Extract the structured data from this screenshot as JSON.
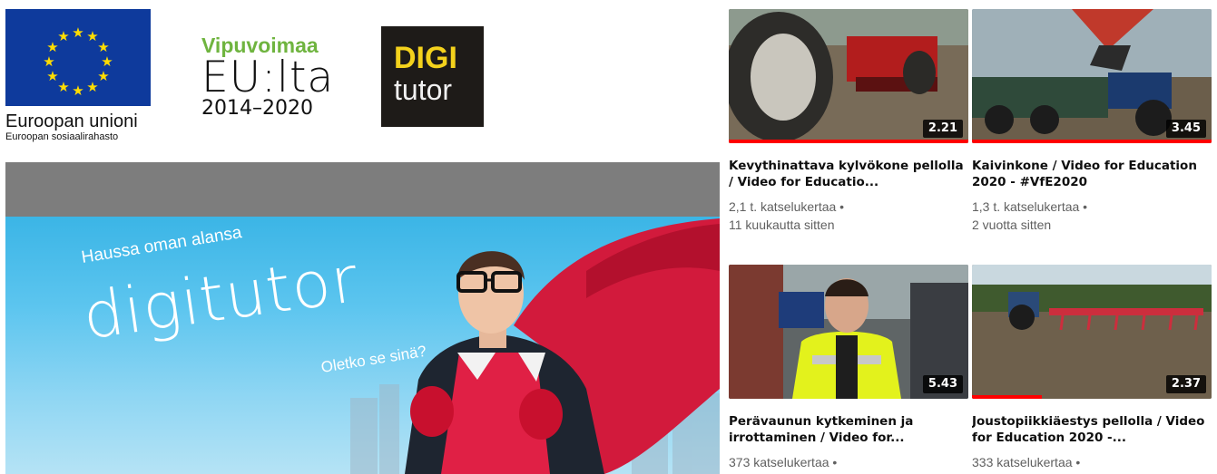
{
  "logos": {
    "eu": {
      "name": "Euroopan unioni",
      "subtitle": "Euroopan sosiaalirahasto",
      "flag_color": "#0e3a9c",
      "star_color": "#ffdd00"
    },
    "vipuvoimaa": {
      "line1": "Vipuvoimaa",
      "line2": "EU:lta",
      "line3": "2014–2020",
      "green": "#6fb43f"
    },
    "digitutor": {
      "line1": "DIGI",
      "line2": "tutor",
      "yellow": "#f4d21c",
      "background": "#1e1b18"
    }
  },
  "banner": {
    "tagline": "Haussa oman alansa",
    "brand": "digitutor",
    "question": "Oletko se sinä?",
    "cape_color": "#d21a3c"
  },
  "videos": [
    {
      "title": "Kevythinattava kylvökone pellolla / Video for Educatio...",
      "duration": "2.21",
      "views": "2,1 t. katselukertaa •",
      "age": "11 kuukautta sitten",
      "watched": 1.0,
      "thumbnail_icon": "tractor-wheel-seeder-thumbnail"
    },
    {
      "title": "Kaivinkone / Video for Education 2020 - #VfE2020",
      "duration": "3.45",
      "views": "1,3 t. katselukertaa •",
      "age": "2 vuotta sitten",
      "watched": 1.0,
      "thumbnail_icon": "excavator-trailer-thumbnail"
    },
    {
      "title": "Perävaunun kytkeminen ja irrottaminen / Video for...",
      "duration": "5.43",
      "views": "373 katselukertaa •",
      "age": "",
      "watched": 0,
      "thumbnail_icon": "man-hivis-jacket-thumbnail"
    },
    {
      "title": "Joustopiikkiäestys pellolla / Video for Education 2020 -...",
      "duration": "2.37",
      "views": "333 katselukertaa •",
      "age": "",
      "watched": 0.29,
      "thumbnail_icon": "tractor-harrow-field-thumbnail"
    }
  ]
}
